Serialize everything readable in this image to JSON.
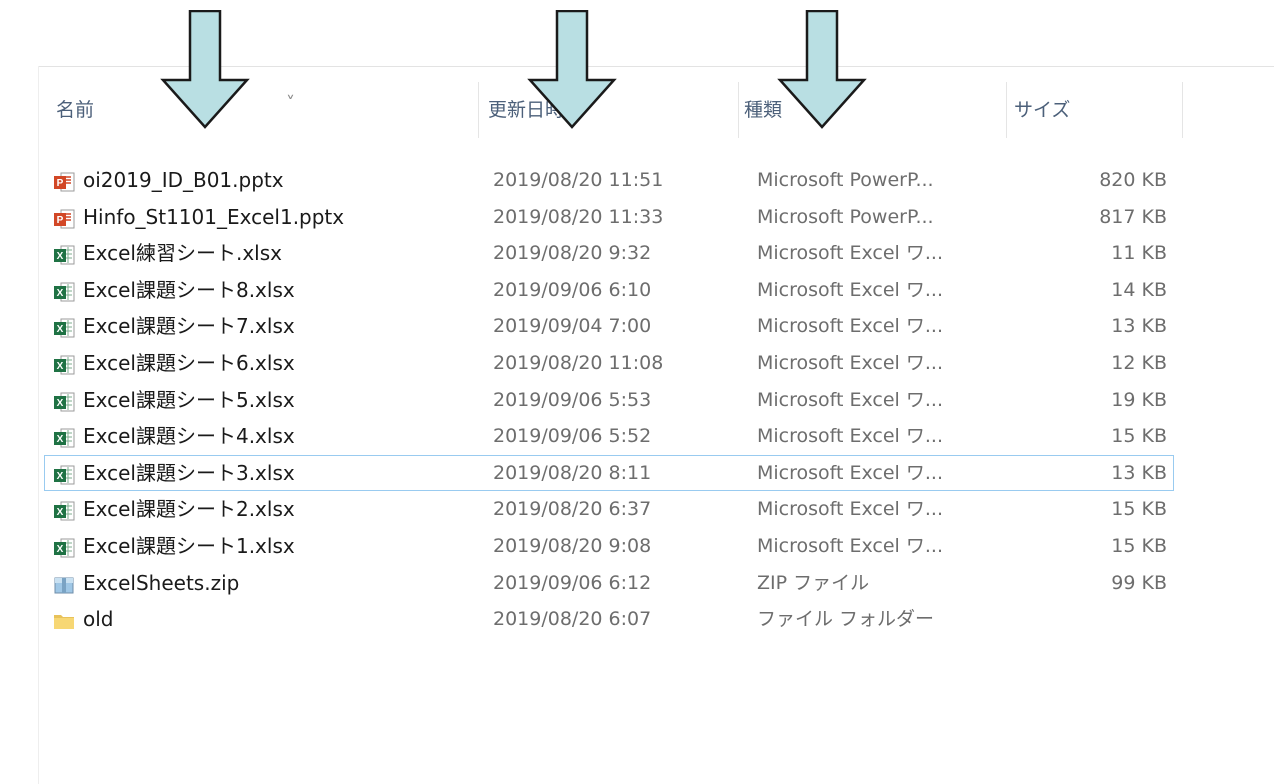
{
  "columns": {
    "name": "名前",
    "date": "更新日時",
    "type": "種類",
    "size": "サイズ"
  },
  "sort_indicator": "˅",
  "files": [
    {
      "icon": "powerpoint-icon",
      "name": "oi2019_ID_B01.pptx",
      "date": "2019/08/20 11:51",
      "type": "Microsoft PowerP...",
      "size": "820 KB"
    },
    {
      "icon": "powerpoint-icon",
      "name": "Hinfo_St1101_Excel1.pptx",
      "date": "2019/08/20 11:33",
      "type": "Microsoft PowerP...",
      "size": "817 KB"
    },
    {
      "icon": "excel-icon",
      "name": "Excel練習シート.xlsx",
      "date": "2019/08/20 9:32",
      "type": "Microsoft Excel ワ...",
      "size": "11 KB"
    },
    {
      "icon": "excel-icon",
      "name": "Excel課題シート8.xlsx",
      "date": "2019/09/06 6:10",
      "type": "Microsoft Excel ワ...",
      "size": "14 KB"
    },
    {
      "icon": "excel-icon",
      "name": "Excel課題シート7.xlsx",
      "date": "2019/09/04 7:00",
      "type": "Microsoft Excel ワ...",
      "size": "13 KB"
    },
    {
      "icon": "excel-icon",
      "name": "Excel課題シート6.xlsx",
      "date": "2019/08/20 11:08",
      "type": "Microsoft Excel ワ...",
      "size": "12 KB"
    },
    {
      "icon": "excel-icon",
      "name": "Excel課題シート5.xlsx",
      "date": "2019/09/06 5:53",
      "type": "Microsoft Excel ワ...",
      "size": "19 KB"
    },
    {
      "icon": "excel-icon",
      "name": "Excel課題シート4.xlsx",
      "date": "2019/09/06 5:52",
      "type": "Microsoft Excel ワ...",
      "size": "15 KB"
    },
    {
      "icon": "excel-icon",
      "name": "Excel課題シート3.xlsx",
      "date": "2019/08/20 8:11",
      "type": "Microsoft Excel ワ...",
      "size": "13 KB",
      "focused": true
    },
    {
      "icon": "excel-icon",
      "name": "Excel課題シート2.xlsx",
      "date": "2019/08/20 6:37",
      "type": "Microsoft Excel ワ...",
      "size": "15 KB"
    },
    {
      "icon": "excel-icon",
      "name": "Excel課題シート1.xlsx",
      "date": "2019/08/20 9:08",
      "type": "Microsoft Excel ワ...",
      "size": "15 KB"
    },
    {
      "icon": "zip-icon",
      "name": "ExcelSheets.zip",
      "date": "2019/09/06 6:12",
      "type": "ZIP ファイル",
      "size": "99 KB"
    },
    {
      "icon": "folder-icon",
      "name": "old",
      "date": "2019/08/20 6:07",
      "type": "ファイル フォルダー",
      "size": ""
    }
  ],
  "colors": {
    "arrow_fill": "#b9dfe3",
    "header_text": "#4c607a",
    "focus_border": "#99cbf0",
    "powerpoint": "#d24726",
    "excel": "#1f7244",
    "folder": "#f7d774"
  }
}
